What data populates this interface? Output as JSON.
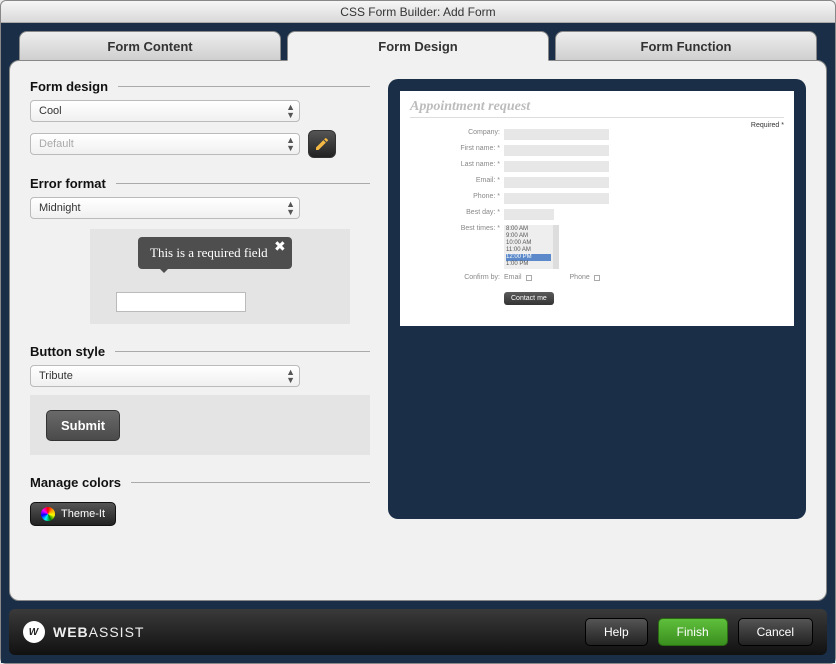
{
  "window_title": "CSS Form Builder: Add Form",
  "tabs": [
    {
      "label": "Form Content"
    },
    {
      "label": "Form Design"
    },
    {
      "label": "Form Function"
    }
  ],
  "active_tab": 1,
  "sections": {
    "form_design": {
      "title": "Form design",
      "preset": "Cool",
      "substyle": "Default"
    },
    "error_format": {
      "title": "Error format",
      "preset": "Midnight",
      "tooltip_text": "This is a required field"
    },
    "button_style": {
      "title": "Button style",
      "preset": "Tribute",
      "sample_label": "Submit"
    },
    "manage_colors": {
      "title": "Manage colors",
      "theme_button": "Theme-It"
    }
  },
  "preview": {
    "form_title": "Appointment request",
    "required_label": "Required *",
    "fields": {
      "company": "Company:",
      "first_name": "First name: *",
      "last_name": "Last name: *",
      "email": "Email: *",
      "phone": "Phone: *",
      "best_day": "Best day: *",
      "best_times": "Best times: *",
      "confirm_by": "Confirm by:"
    },
    "times": [
      "8:00 AM",
      "9:00 AM",
      "10:00 AM",
      "11:00 AM",
      "12:00 PM",
      "1:00 PM"
    ],
    "confirm_options": {
      "email": "Email",
      "phone": "Phone"
    },
    "submit_label": "Contact me"
  },
  "footer": {
    "brand_bold": "WEB",
    "brand_light": "ASSIST",
    "help": "Help",
    "finish": "Finish",
    "cancel": "Cancel"
  }
}
